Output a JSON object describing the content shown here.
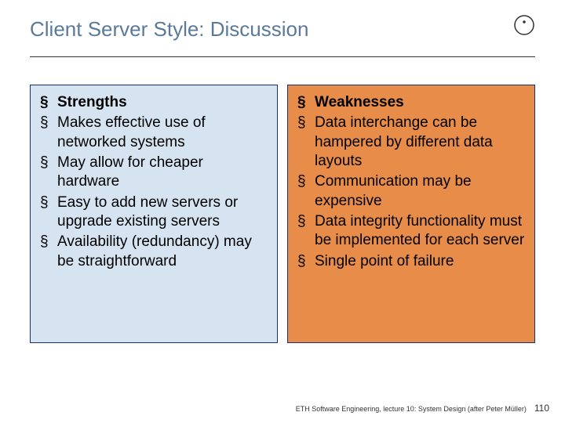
{
  "title": "Client Server Style: Discussion",
  "left": {
    "heading": "Strengths",
    "items": [
      "Makes effective use of networked systems",
      "May allow for cheaper hardware",
      "Easy to add new servers or upgrade existing servers",
      "Availability (redundancy) may be straightforward"
    ]
  },
  "right": {
    "heading": "Weaknesses",
    "items": [
      "Data interchange can be hampered by different data layouts",
      "Communication may be expensive",
      "Data integrity functionality must be implemented for each server",
      "Single point of failure"
    ]
  },
  "footer": {
    "text": "ETH Software Engineering, lecture 10: System Design (after Peter Müller)",
    "page": "110"
  }
}
